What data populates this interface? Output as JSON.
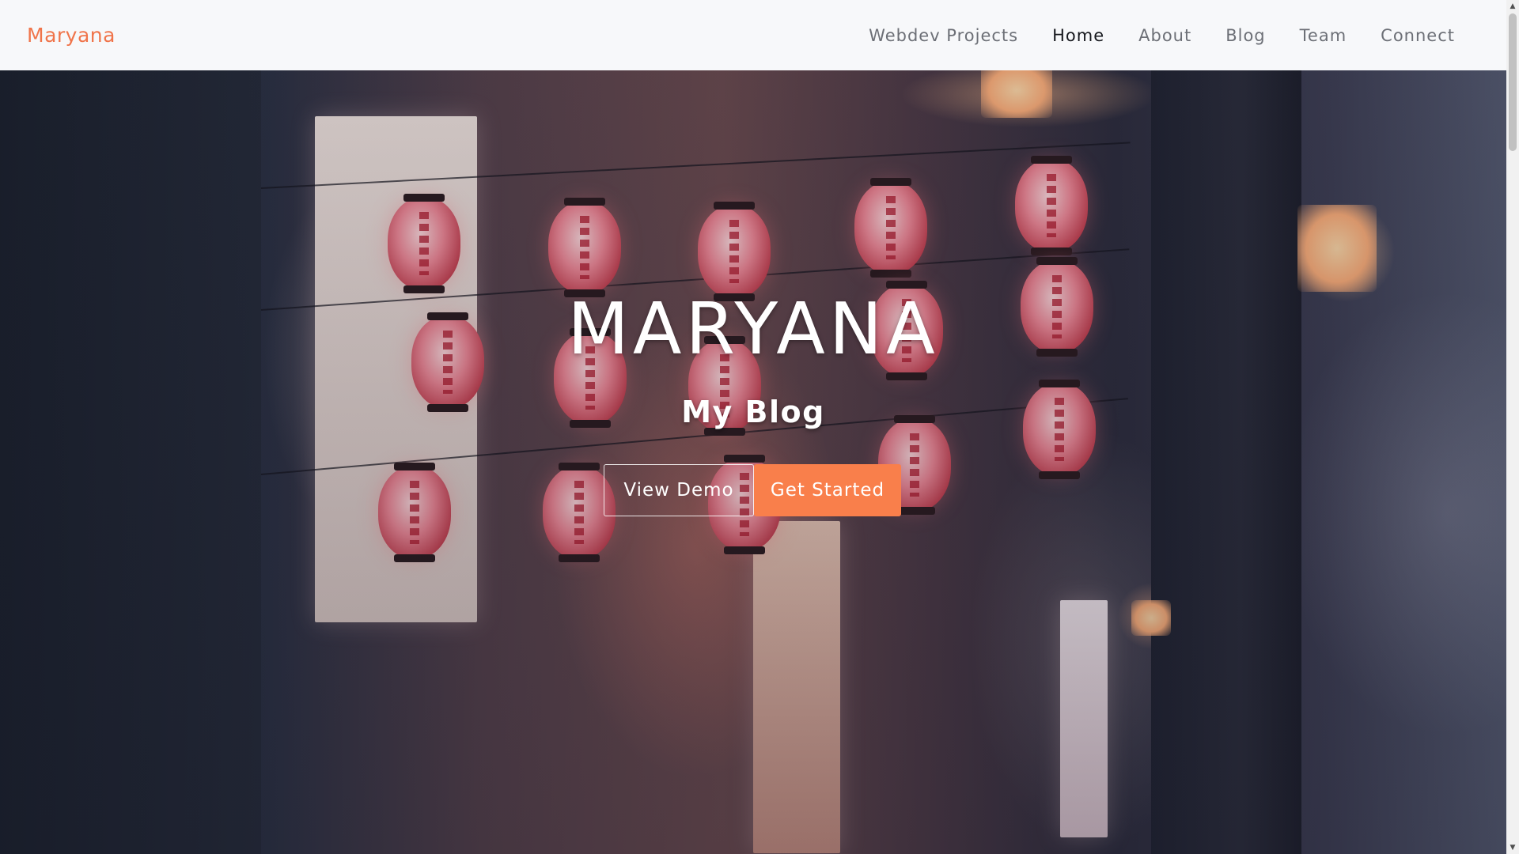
{
  "navbar": {
    "brand": "Maryana",
    "links": [
      {
        "label": "Webdev Projects",
        "active": false
      },
      {
        "label": "Home",
        "active": true
      },
      {
        "label": "About",
        "active": false
      },
      {
        "label": "Blog",
        "active": false
      },
      {
        "label": "Team",
        "active": false
      },
      {
        "label": "Connect",
        "active": false
      }
    ]
  },
  "hero": {
    "title": "MARYANA",
    "subtitle": "My Blog",
    "buttons": {
      "view_demo": "View Demo",
      "get_started": "Get Started"
    }
  },
  "colors": {
    "brand": "#f0744a",
    "accent": "#f97f4b",
    "nav_text": "#6c6f76",
    "nav_active": "#15171c",
    "navbar_bg": "#f7f8fa"
  },
  "scrollbar": {
    "up_arrow": "▲",
    "down_arrow": "▼"
  }
}
